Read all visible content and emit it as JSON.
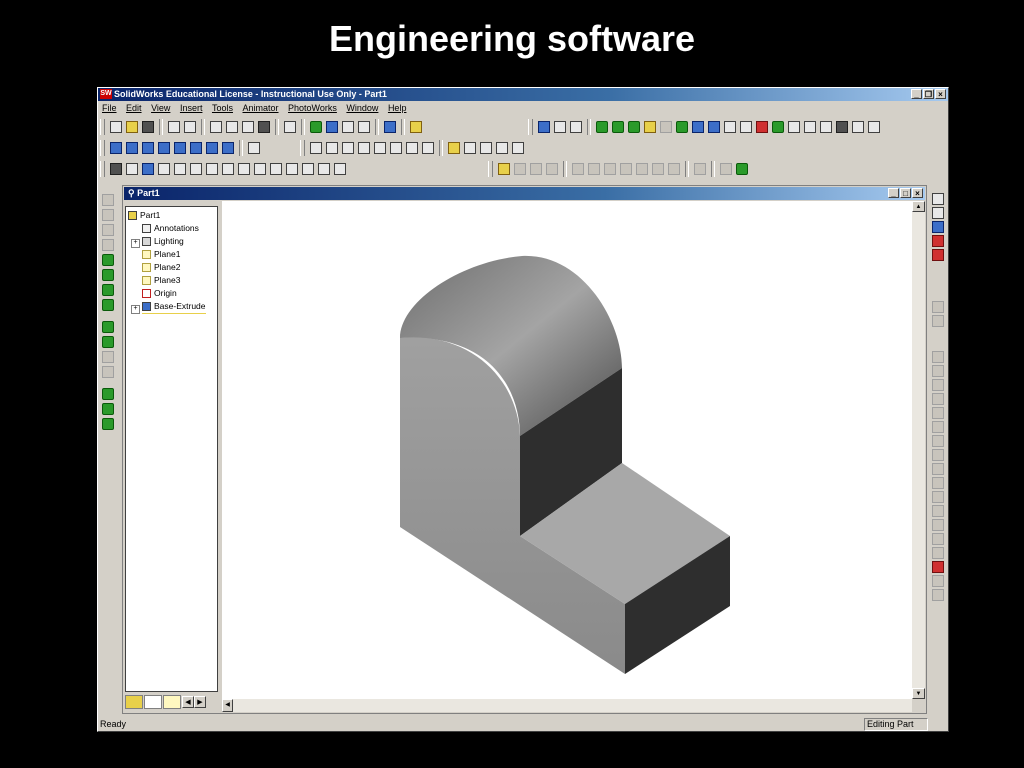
{
  "slide": {
    "title": "Engineering software"
  },
  "window": {
    "logo": "SW",
    "title": "SolidWorks Educational License - Instructional Use Only - Part1",
    "controls": [
      "_",
      "❐",
      "×"
    ]
  },
  "menu": [
    "File",
    "Edit",
    "View",
    "Insert",
    "Tools",
    "Animator",
    "PhotoWorks",
    "Window",
    "Help"
  ],
  "document": {
    "title": "Part1",
    "controls": [
      "_",
      "□",
      "×"
    ]
  },
  "feature_tree": [
    {
      "label": "Part1",
      "icon": "part-icon",
      "expandable": false
    },
    {
      "label": "Annotations",
      "icon": "annotations-icon",
      "expandable": false
    },
    {
      "label": "Lighting",
      "icon": "lighting-icon",
      "expandable": true
    },
    {
      "label": "Plane1",
      "icon": "plane-icon",
      "expandable": false
    },
    {
      "label": "Plane2",
      "icon": "plane-icon",
      "expandable": false
    },
    {
      "label": "Plane3",
      "icon": "plane-icon",
      "expandable": false
    },
    {
      "label": "Origin",
      "icon": "origin-icon",
      "expandable": false
    },
    {
      "label": "Base-Extrude",
      "icon": "extrude-icon",
      "expandable": true
    }
  ],
  "status": {
    "left": "Ready",
    "right": "Editing Part"
  },
  "colors": {
    "titlebar": "#0a246a",
    "chrome": "#d4d0c8",
    "viewport": "#ffffff",
    "model_top": "#a8a8a8",
    "model_front": "#8c8c8c",
    "model_dark": "#2e2e2e"
  }
}
